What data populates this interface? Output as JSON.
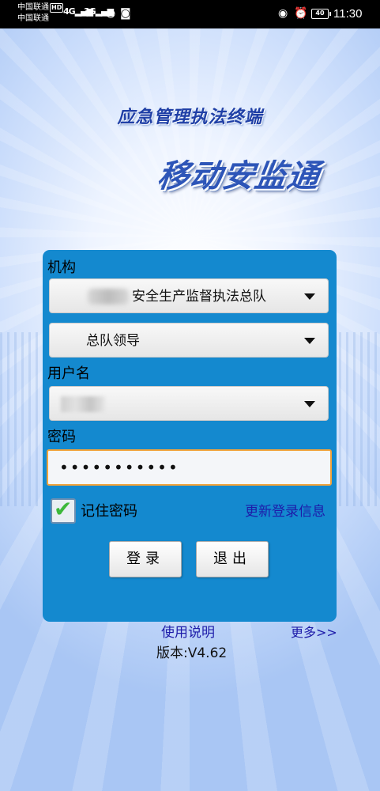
{
  "status_bar": {
    "carrier_primary": "中国联通",
    "carrier_secondary": "中国联通",
    "hd_badge": "HD",
    "signal_1": "4G",
    "signal_2": "3G",
    "battery": "40",
    "time": "11:30"
  },
  "header": {
    "app_title": "应急管理执法终端",
    "logo_text": "移动安监通"
  },
  "form": {
    "org_label": "机构",
    "org_value": "安全生产监督执法总队",
    "dept_value": "总队领导",
    "username_label": "用户名",
    "password_label": "密码",
    "password_value": "•••••••••••",
    "remember_label": "记住密码",
    "remember_checked": true,
    "update_link": "更新登录信息",
    "login_button": "登录",
    "exit_button": "退出"
  },
  "footer": {
    "help_link": "使用说明",
    "more_link": "更多>>",
    "version": "版本:V4.62"
  },
  "colors": {
    "panel": "#1489cf",
    "focus_border": "#f2a33a",
    "link": "#1d1ba9",
    "title": "#1f3fa6"
  }
}
